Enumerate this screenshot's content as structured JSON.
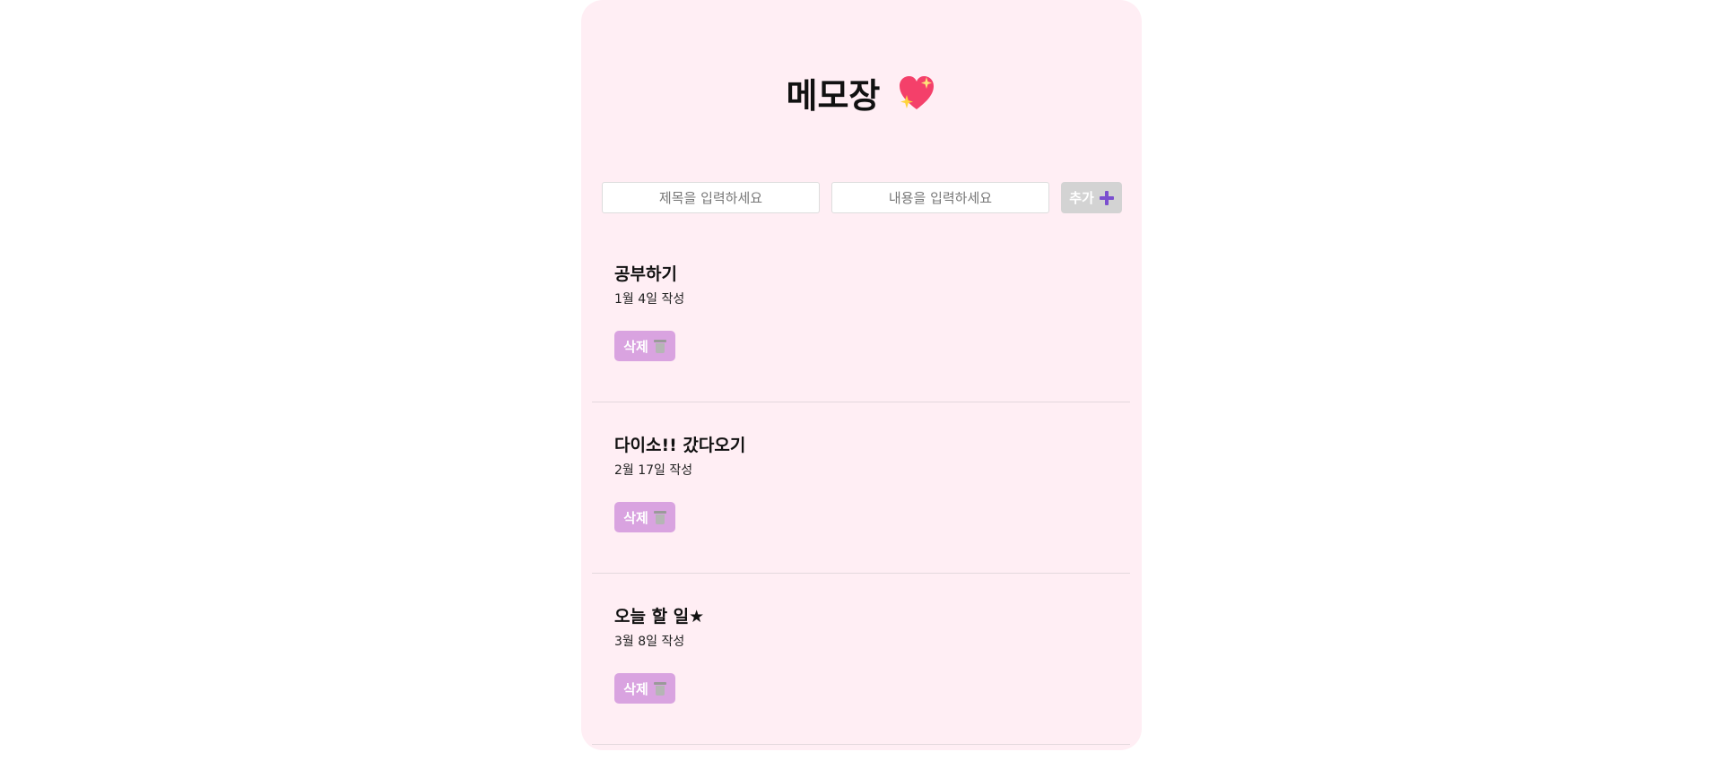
{
  "header": {
    "title": "메모장",
    "icon": "sparkling-heart-icon"
  },
  "form": {
    "title_placeholder": "제목을 입력하세요",
    "content_placeholder": "내용을 입력하세요",
    "add_label": "추가",
    "add_icon": "plus-icon"
  },
  "memos": [
    {
      "title": "공부하기",
      "date": "1월 4일 작성",
      "delete_label": "삭제"
    },
    {
      "title": "다이소!! 갔다오기",
      "date": "2월 17일 작성",
      "delete_label": "삭제"
    },
    {
      "title": "오늘 할 일★",
      "date": "3월 8일 작성",
      "delete_label": "삭제"
    }
  ],
  "colors": {
    "card_background": "#ffeef4",
    "add_button": "#d3d3d3",
    "delete_button": "#d9a3e0",
    "plus_icon": "#7b4fcf"
  }
}
